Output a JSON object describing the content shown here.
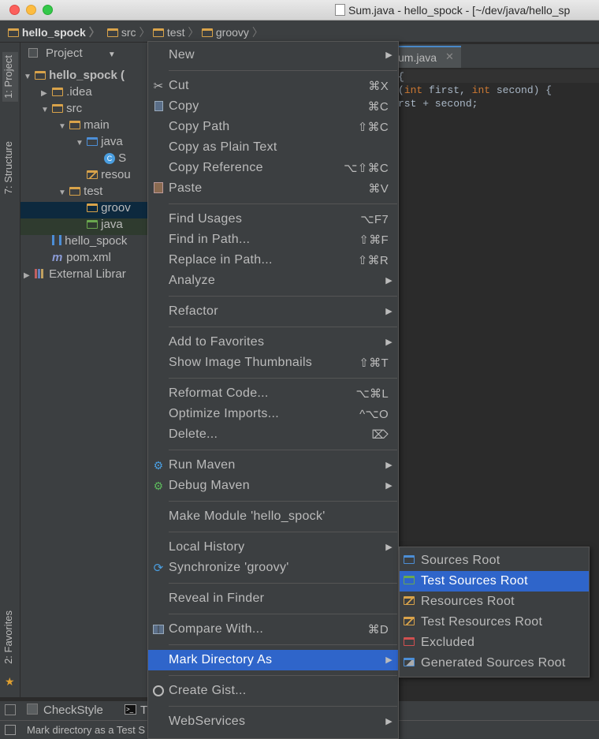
{
  "window": {
    "title": "Sum.java - hello_spock - [~/dev/java/hello_sp"
  },
  "navbar": {
    "crumbs": [
      "hello_spock",
      "src",
      "test",
      "groovy"
    ]
  },
  "left_strip": {
    "project_tab": "1: Project",
    "structure_tab": "7: Structure",
    "favorites_tab": "2: Favorites"
  },
  "project_panel": {
    "header": "Project",
    "tree": [
      {
        "label": "hello_spock (",
        "indent": 0,
        "arrow": "▼",
        "icon": "module-folder"
      },
      {
        "label": ".idea",
        "indent": 1,
        "arrow": "▶",
        "icon": "folder"
      },
      {
        "label": "src",
        "indent": 1,
        "arrow": "▼",
        "icon": "folder"
      },
      {
        "label": "main",
        "indent": 2,
        "arrow": "▼",
        "icon": "folder"
      },
      {
        "label": "java",
        "indent": 3,
        "arrow": "▼",
        "icon": "source-folder"
      },
      {
        "label": "S",
        "indent": 4,
        "arrow": "",
        "icon": "class"
      },
      {
        "label": "resou",
        "indent": 3,
        "arrow": "",
        "icon": "resource-folder"
      },
      {
        "label": "test",
        "indent": 2,
        "arrow": "▼",
        "icon": "folder"
      },
      {
        "label": "groov",
        "indent": 3,
        "arrow": "",
        "icon": "folder"
      },
      {
        "label": "java",
        "indent": 3,
        "arrow": "",
        "icon": "test-folder"
      },
      {
        "label": "hello_spock",
        "indent": 1,
        "arrow": "",
        "icon": "iml-file"
      },
      {
        "label": "pom.xml",
        "indent": 1,
        "arrow": "",
        "icon": "maven-file"
      },
      {
        "label": "External Librar",
        "indent": 0,
        "arrow": "▶",
        "icon": "library"
      }
    ]
  },
  "editor": {
    "tab_label": "um.java",
    "code_lines": [
      "{",
      "(int first, int second) {",
      "rst + second;"
    ]
  },
  "context_menu": {
    "items": [
      {
        "label": "New",
        "shortcut": "",
        "submenu": true,
        "icon": ""
      },
      {
        "sep": true
      },
      {
        "label": "Cut",
        "shortcut": "⌘X",
        "icon": "scissors-icon"
      },
      {
        "label": "Copy",
        "shortcut": "⌘C",
        "icon": "copy-icon"
      },
      {
        "label": "Copy Path",
        "shortcut": "⇧⌘C",
        "icon": ""
      },
      {
        "label": "Copy as Plain Text",
        "shortcut": "",
        "icon": ""
      },
      {
        "label": "Copy Reference",
        "shortcut": "⌥⇧⌘C",
        "icon": ""
      },
      {
        "label": "Paste",
        "shortcut": "⌘V",
        "icon": "paste-icon"
      },
      {
        "sep": true
      },
      {
        "label": "Find Usages",
        "shortcut": "⌥F7",
        "icon": ""
      },
      {
        "label": "Find in Path...",
        "shortcut": "⇧⌘F",
        "icon": ""
      },
      {
        "label": "Replace in Path...",
        "shortcut": "⇧⌘R",
        "icon": ""
      },
      {
        "label": "Analyze",
        "shortcut": "",
        "submenu": true,
        "icon": ""
      },
      {
        "sep": true
      },
      {
        "label": "Refactor",
        "shortcut": "",
        "submenu": true,
        "icon": ""
      },
      {
        "sep": true
      },
      {
        "label": "Add to Favorites",
        "shortcut": "",
        "submenu": true,
        "icon": ""
      },
      {
        "label": "Show Image Thumbnails",
        "shortcut": "⇧⌘T",
        "icon": ""
      },
      {
        "sep": true
      },
      {
        "label": "Reformat Code...",
        "shortcut": "⌥⌘L",
        "icon": ""
      },
      {
        "label": "Optimize Imports...",
        "shortcut": "^⌥O",
        "icon": ""
      },
      {
        "label": "Delete...",
        "shortcut": "⌦",
        "icon": ""
      },
      {
        "sep": true
      },
      {
        "label": "Run Maven",
        "shortcut": "",
        "submenu": true,
        "icon": "gear-icon"
      },
      {
        "label": "Debug Maven",
        "shortcut": "",
        "submenu": true,
        "icon": "debug-gear-icon"
      },
      {
        "sep": true
      },
      {
        "label": "Make Module 'hello_spock'",
        "shortcut": "",
        "icon": ""
      },
      {
        "sep": true
      },
      {
        "label": "Local History",
        "shortcut": "",
        "submenu": true,
        "icon": ""
      },
      {
        "label": "Synchronize 'groovy'",
        "shortcut": "",
        "icon": "sync-icon"
      },
      {
        "sep": true
      },
      {
        "label": "Reveal in Finder",
        "shortcut": "",
        "icon": ""
      },
      {
        "sep": true
      },
      {
        "label": "Compare With...",
        "shortcut": "⌘D",
        "icon": "compare-icon"
      },
      {
        "sep": true
      },
      {
        "label": "Mark Directory As",
        "shortcut": "",
        "submenu": true,
        "icon": "",
        "selected": true
      },
      {
        "sep": true
      },
      {
        "label": "Create Gist...",
        "shortcut": "",
        "icon": "github-icon"
      },
      {
        "sep": true
      },
      {
        "label": "WebServices",
        "shortcut": "",
        "submenu": true,
        "icon": ""
      }
    ]
  },
  "submenu": {
    "items": [
      {
        "label": "Sources Root",
        "icon": "blue"
      },
      {
        "label": "Test Sources Root",
        "icon": "green",
        "selected": true
      },
      {
        "label": "Resources Root",
        "icon": "orange"
      },
      {
        "label": "Test Resources Root",
        "icon": "orange"
      },
      {
        "label": "Excluded",
        "icon": "red"
      },
      {
        "label": "Generated Sources Root",
        "icon": "gen"
      }
    ]
  },
  "bottom_bar": {
    "checkstyle": "CheckStyle",
    "terminal": "T"
  },
  "status_bar": {
    "text": "Mark directory as a Test S"
  },
  "colors": {
    "selection": "#2f65ca",
    "menu_bg": "#3c3f41",
    "editor_bg": "#2b2b2b",
    "keyword": "#cc7832"
  }
}
